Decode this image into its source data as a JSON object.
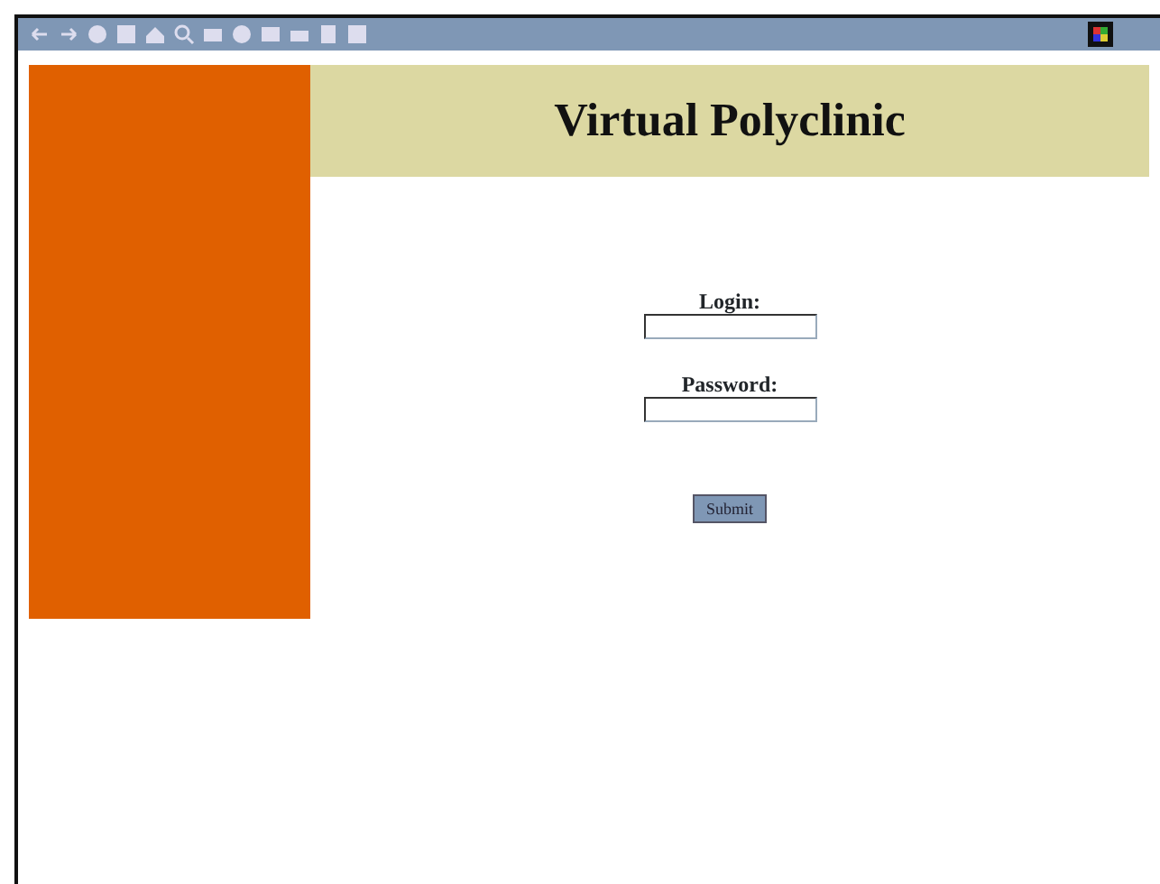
{
  "header": {
    "title": "Virtual Polyclinic"
  },
  "fields": [
    {
      "label": "Login:"
    },
    {
      "label": "Password:"
    }
  ],
  "submit_button": {
    "label": "Submit"
  }
}
